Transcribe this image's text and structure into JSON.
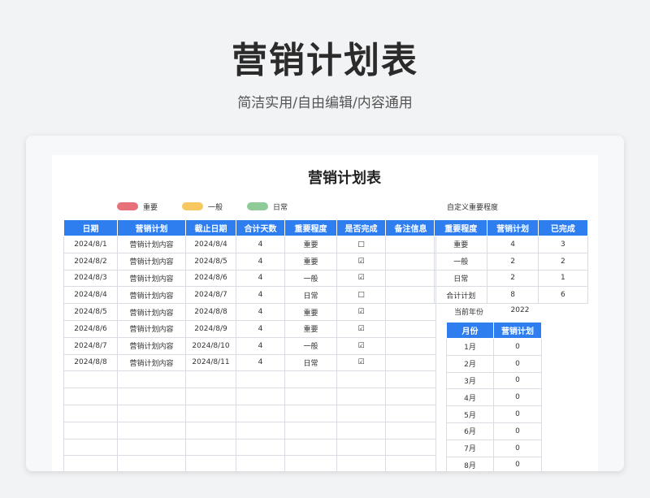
{
  "header": {
    "title": "营销计划表",
    "subtitle": "简洁实用/自由编辑/内容通用"
  },
  "sheet": {
    "title": "营销计划表",
    "legend": [
      {
        "label": "重要",
        "color": "#e8707a"
      },
      {
        "label": "一般",
        "color": "#f6c85f"
      },
      {
        "label": "日常",
        "color": "#8fcb98"
      }
    ],
    "custom_label": "自定义重要程度"
  },
  "main_table": {
    "headers": [
      "日期",
      "营销计划",
      "截止日期",
      "合计天数",
      "重要程度",
      "是否完成",
      "备注信息"
    ],
    "rows": [
      [
        "2024/8/1",
        "营销计划内容",
        "2024/8/4",
        "4",
        "重要",
        "□",
        ""
      ],
      [
        "2024/8/2",
        "营销计划内容",
        "2024/8/5",
        "4",
        "重要",
        "☑",
        ""
      ],
      [
        "2024/8/3",
        "营销计划内容",
        "2024/8/6",
        "4",
        "一般",
        "☑",
        ""
      ],
      [
        "2024/8/4",
        "营销计划内容",
        "2024/8/7",
        "4",
        "日常",
        "□",
        ""
      ],
      [
        "2024/8/5",
        "营销计划内容",
        "2024/8/8",
        "4",
        "重要",
        "☑",
        ""
      ],
      [
        "2024/8/6",
        "营销计划内容",
        "2024/8/9",
        "4",
        "重要",
        "☑",
        ""
      ],
      [
        "2024/8/7",
        "营销计划内容",
        "2024/8/10",
        "4",
        "一般",
        "☑",
        ""
      ],
      [
        "2024/8/8",
        "营销计划内容",
        "2024/8/11",
        "4",
        "日常",
        "☑",
        ""
      ]
    ],
    "empty_rows": 6
  },
  "summary_table": {
    "headers": [
      "重要程度",
      "营销计划",
      "已完成"
    ],
    "rows": [
      [
        "重要",
        "4",
        "3"
      ],
      [
        "一般",
        "2",
        "2"
      ],
      [
        "日常",
        "2",
        "1"
      ],
      [
        "合计计划",
        "8",
        "6"
      ]
    ]
  },
  "year": {
    "label": "当前年份",
    "value": "2022"
  },
  "month_table": {
    "headers": [
      "月份",
      "营销计划"
    ],
    "rows": [
      [
        "1月",
        "0"
      ],
      [
        "2月",
        "0"
      ],
      [
        "3月",
        "0"
      ],
      [
        "4月",
        "0"
      ],
      [
        "5月",
        "0"
      ],
      [
        "6月",
        "0"
      ],
      [
        "7月",
        "0"
      ],
      [
        "8月",
        "0"
      ]
    ]
  },
  "colors": {
    "header_blue": "#2f7ef0",
    "background": "#f2f3f5"
  }
}
